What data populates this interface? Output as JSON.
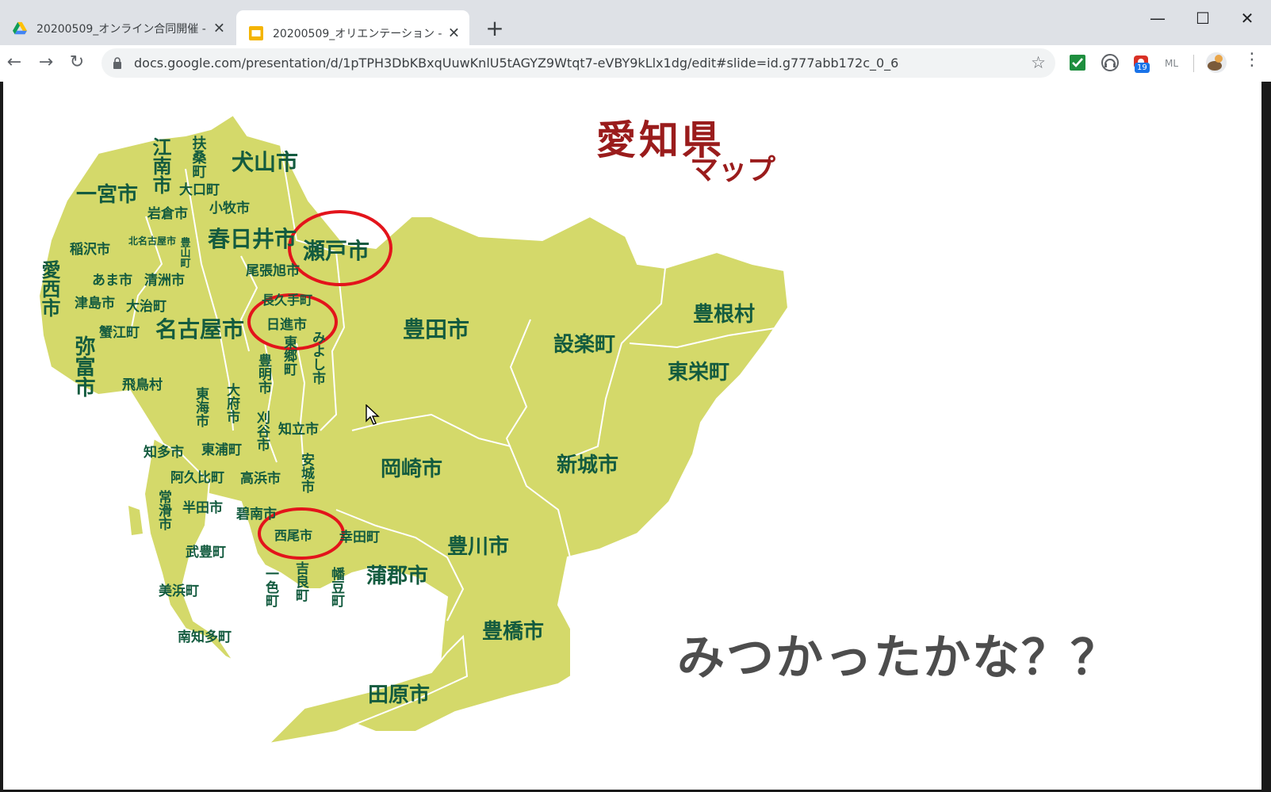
{
  "browser": {
    "tabs": [
      {
        "title": "20200509_オンライン合同開催 - Go",
        "favicon": "google-drive-icon",
        "active": false
      },
      {
        "title": "20200509_オリエンテーション - Goog",
        "favicon": "google-slides-icon",
        "active": true
      }
    ],
    "new_tab": "+",
    "url": "docs.google.com/presentation/d/1pTPH3DbKBxqUuwKnlU5tAGYZ9Wtqt7-eVBY9kLlx1dg/edit#slide=id.g777abb172c_0_6",
    "extension_badge": "19",
    "extensions": [
      "green-check-icon",
      "headphones-icon",
      "notification-icon",
      "ml-icon",
      "profile-avatar"
    ],
    "colors": {
      "tab_bar": "#dee1e6",
      "omnibox": "#f1f3f4",
      "slides_accent": "#f4b400",
      "drive_green": "#0f9d58"
    }
  },
  "slide": {
    "title": "愛知県",
    "subtitle": "マップ",
    "question": "みつかったかな？？",
    "map_fill": "#d4d96a",
    "title_color": "#9a1c1c",
    "label_color": "#135b3f",
    "circle_color": "#e3141b",
    "cities": {
      "konan": "江南市",
      "fuso": "扶桑町",
      "inuyama": "犬山市",
      "ichinomiya": "一宮市",
      "oguchi": "大口町",
      "iwakura": "岩倉市",
      "komaki": "小牧市",
      "inazawa": "稲沢市",
      "kitanagoya": "北名古屋市",
      "toyoyama": "豊山町",
      "kasugai": "春日井市",
      "seto": "瀬戸市",
      "aisai": "愛西市",
      "owariasahi": "尾張旭市",
      "ama": "あま市",
      "kiyosu": "清洲市",
      "tsushima": "津島市",
      "oharu": "大治町",
      "nagakute": "長久手町",
      "nisshin": "日進市",
      "toyota": "豊田市",
      "kanie": "蟹江町",
      "nagoya": "名古屋市",
      "shitara": "設楽町",
      "toyone": "豊根村",
      "yatomi": "弥富市",
      "togo": "東郷町",
      "miyoshi": "みよし市",
      "toei": "東栄町",
      "toyoake": "豊明市",
      "tobishima": "飛鳥村",
      "tokai": "東海市",
      "obu": "大府市",
      "kariya": "刈谷市",
      "chiryu": "知立市",
      "chita": "知多市",
      "higashiura": "東浦町",
      "anjo": "安城市",
      "okazaki": "岡崎市",
      "shinshiro": "新城市",
      "agui": "阿久比町",
      "takahama": "高浜市",
      "tokoname": "常滑市",
      "handa": "半田市",
      "hekinan": "碧南市",
      "nishio": "西尾市",
      "kota": "幸田町",
      "toyokawa": "豊川市",
      "taketoyo": "武豊町",
      "isshiki": "一色町",
      "kira": "吉良町",
      "hazu": "幡豆町",
      "gamagori": "蒲郡市",
      "mihama": "美浜町",
      "minamichita": "南知多町",
      "toyohashi": "豊橋市",
      "tahara": "田原市"
    }
  }
}
